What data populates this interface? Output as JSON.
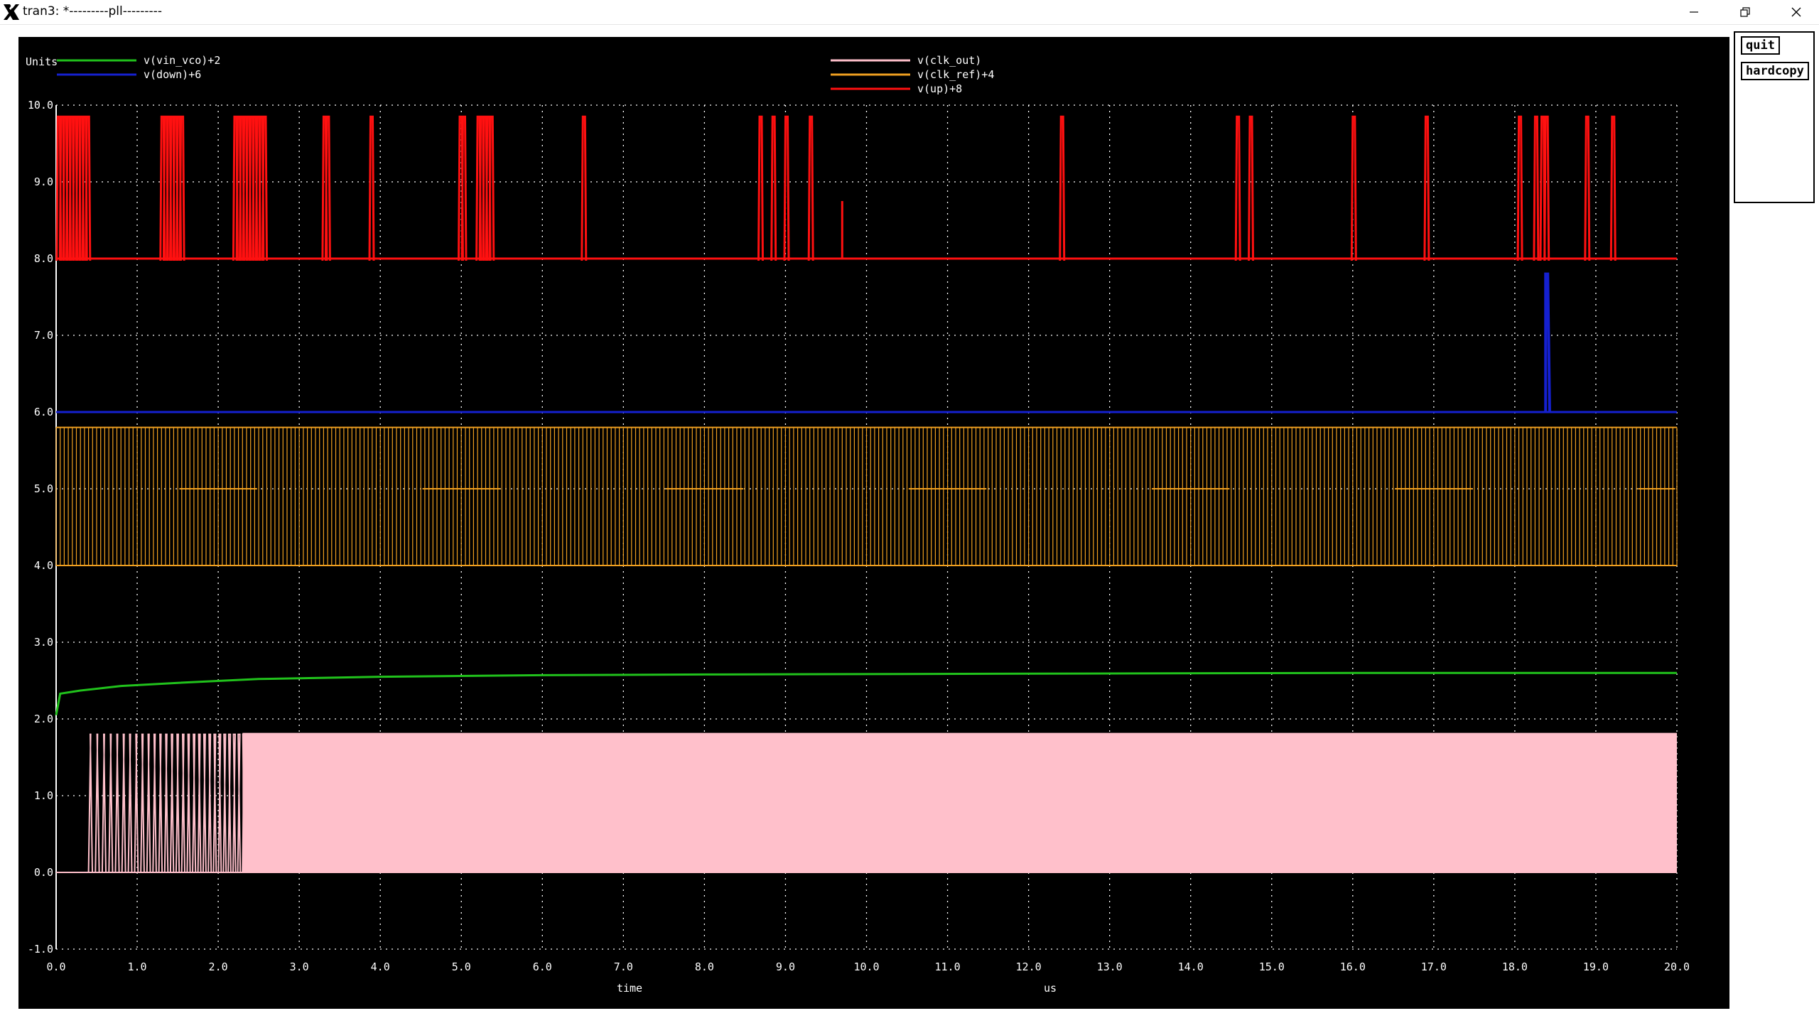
{
  "window": {
    "title": "tran3: *---------pll---------",
    "icon": "x-window-icon",
    "controls": [
      "minimize-icon",
      "maximize-icon",
      "close-icon"
    ]
  },
  "side_panel": {
    "quit_label": "quit",
    "hardcopy_label": "hardcopy"
  },
  "colors": {
    "background": "#000000",
    "grid": "#ffffff",
    "vin_vco": "#21c21c",
    "down": "#1520d0",
    "clk_out": "#ffc0cb",
    "clk_ref": "#f0a020",
    "up": "#ff1010"
  },
  "chart_data": {
    "type": "line",
    "units_label": "Units",
    "xlabel": "time",
    "x_units": "us",
    "xlim": [
      0,
      20
    ],
    "ylim": [
      -1,
      10
    ],
    "grid": true,
    "x_ticks": [
      "0.0",
      "1.0",
      "2.0",
      "3.0",
      "4.0",
      "5.0",
      "6.0",
      "7.0",
      "8.0",
      "9.0",
      "10.0",
      "11.0",
      "12.0",
      "13.0",
      "14.0",
      "15.0",
      "16.0",
      "17.0",
      "18.0",
      "19.0",
      "20.0"
    ],
    "y_ticks": [
      "10.0",
      "9.0",
      "8.0",
      "7.0",
      "6.0",
      "5.0",
      "4.0",
      "3.0",
      "2.0",
      "1.0",
      "0.0",
      "-1.0"
    ],
    "legend": [
      {
        "label": "v(vin_vco)+2",
        "color": "#21c21c"
      },
      {
        "label": "v(down)+6",
        "color": "#1520d0"
      },
      {
        "label": "v(clk_out)",
        "color": "#ffc0cb"
      },
      {
        "label": "v(clk_ref)+4",
        "color": "#f0a020"
      },
      {
        "label": "v(up)+8",
        "color": "#ff1010"
      }
    ],
    "series": [
      {
        "name": "v(vin_vco)+2",
        "x": [
          0,
          0.05,
          0.3,
          0.8,
          1.5,
          2.5,
          4,
          6,
          8,
          12,
          16,
          20
        ],
        "y": [
          2.05,
          2.33,
          2.37,
          2.43,
          2.47,
          2.52,
          2.55,
          2.57,
          2.58,
          2.59,
          2.6,
          2.6
        ]
      },
      {
        "name": "v(down)+6",
        "baseline": 6.0,
        "pulses": [
          {
            "t": 18.38,
            "width": 0.05,
            "peak": 7.8
          }
        ]
      },
      {
        "name": "v(clk_out)",
        "low": 0.0,
        "high": 1.8,
        "start": 0.4,
        "sparse_edges_until": 2.3,
        "dense_until": 20.0
      },
      {
        "name": "v(clk_ref)+4",
        "low": 4.0,
        "high": 5.8,
        "period": 0.1,
        "gap_level": 5.0,
        "gaps": [
          [
            1.5,
            2.5
          ],
          [
            4.5,
            5.5
          ],
          [
            7.5,
            8.5
          ],
          [
            10.5,
            11.5
          ],
          [
            13.5,
            14.5
          ],
          [
            16.5,
            17.5
          ],
          [
            19.5,
            20.0
          ]
        ]
      },
      {
        "name": "v(up)+8",
        "baseline": 8.0,
        "peak": 9.85,
        "pulses": [
          0.02,
          0.06,
          0.1,
          0.14,
          0.18,
          0.22,
          0.26,
          0.3,
          0.34,
          0.38,
          1.3,
          1.34,
          1.38,
          1.42,
          1.46,
          1.5,
          1.54,
          2.2,
          2.24,
          2.28,
          2.32,
          2.36,
          2.4,
          2.44,
          2.48,
          2.52,
          2.56,
          3.3,
          3.34,
          3.88,
          4.98,
          5.02,
          5.2,
          5.24,
          5.28,
          5.32,
          5.36,
          6.5,
          8.68,
          8.84,
          9.0,
          9.3,
          12.4,
          14.57,
          14.73,
          16.0,
          16.9,
          18.05,
          18.25,
          18.33,
          18.38,
          18.88,
          19.2
        ],
        "small_pulses": [
          {
            "t": 9.7,
            "peak": 8.75
          }
        ]
      }
    ]
  }
}
